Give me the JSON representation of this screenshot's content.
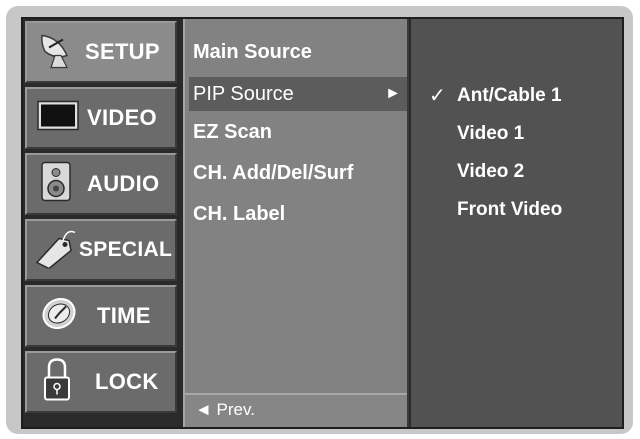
{
  "menu": {
    "items": [
      {
        "label": "SETUP",
        "icon": "satellite-dish-icon",
        "active": true
      },
      {
        "label": "VIDEO",
        "icon": "monitor-icon"
      },
      {
        "label": "AUDIO",
        "icon": "speaker-icon"
      },
      {
        "label": "SPECIAL",
        "icon": "tag-icon"
      },
      {
        "label": "TIME",
        "icon": "clock-icon"
      },
      {
        "label": "LOCK",
        "icon": "padlock-icon"
      }
    ]
  },
  "submenu": {
    "items": [
      {
        "label": "Main Source"
      },
      {
        "label": "PIP Source",
        "selected": true,
        "arrow": "►"
      },
      {
        "label": "EZ Scan"
      },
      {
        "label": "CH. Add/Del/Surf"
      },
      {
        "label": "CH. Label"
      }
    ],
    "prev_label": "◄ Prev."
  },
  "options": {
    "items": [
      {
        "label": "Ant/Cable 1",
        "checked": true,
        "check_mark": "✓"
      },
      {
        "label": "Video 1"
      },
      {
        "label": "Video 2"
      },
      {
        "label": "Front Video"
      }
    ]
  },
  "colors": {
    "frame": "#c7c7c7",
    "menu_tile": "#6b6b6b",
    "menu_tile_active": "#8b8b8b",
    "submenu_bg": "#828282",
    "submenu_selected": "#5c5c5c",
    "options_bg": "#525252"
  }
}
